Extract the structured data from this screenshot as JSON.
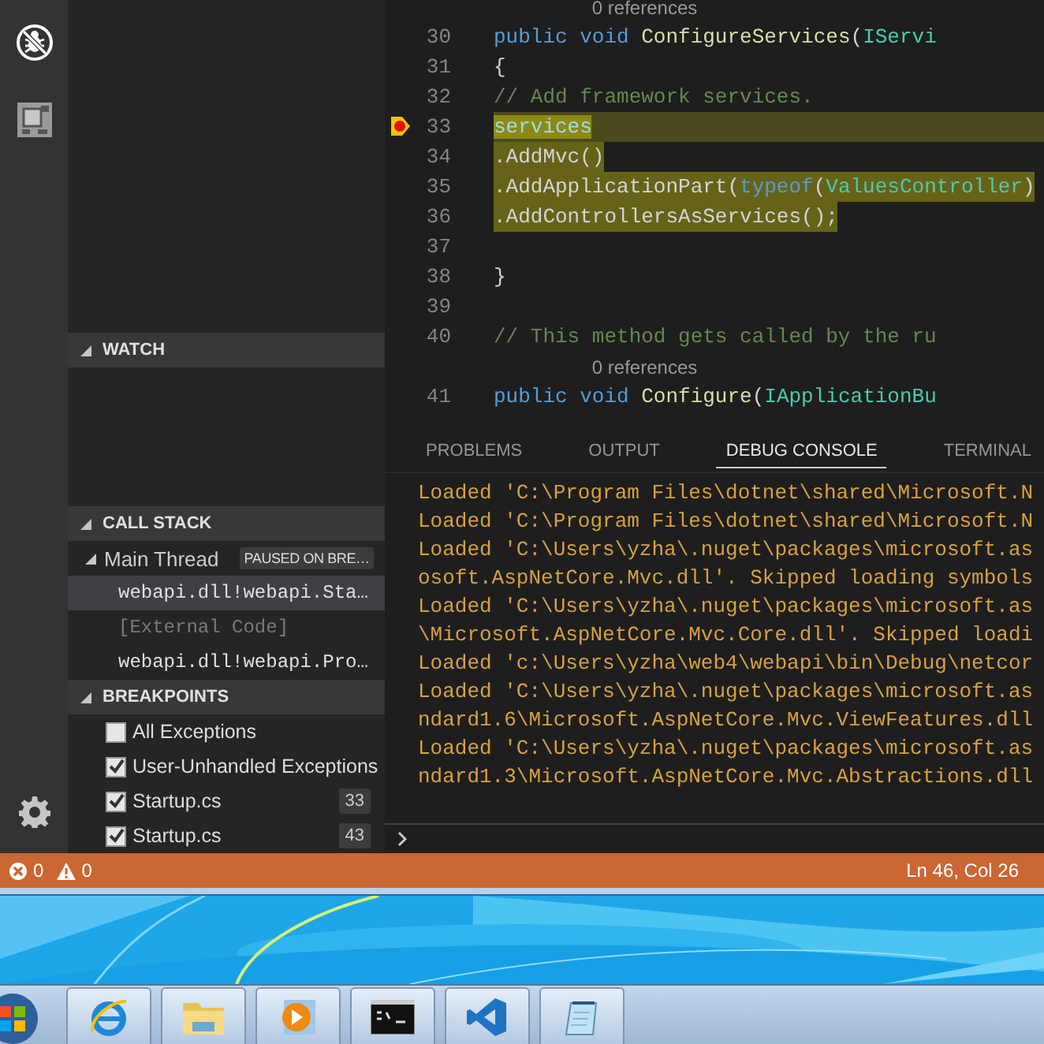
{
  "sidebar": {
    "watch": {
      "title": "WATCH",
      "expanded": true
    },
    "call_stack": {
      "title": "CALL STACK",
      "expanded": true,
      "thread": {
        "name": "Main Thread",
        "expanded": true,
        "badge": "PAUSED ON BRE…"
      },
      "frames": [
        {
          "label": "webapi.dll!webapi.Sta…",
          "kind": "frame",
          "selected": true
        },
        {
          "label": "[External Code]",
          "kind": "external",
          "selected": false
        },
        {
          "label": "webapi.dll!webapi.Pro…",
          "kind": "frame",
          "selected": false
        }
      ]
    },
    "breakpoints": {
      "title": "BREAKPOINTS",
      "expanded": true,
      "items": [
        {
          "label": "All Exceptions",
          "checked": false
        },
        {
          "label": "User-Unhandled Exceptions",
          "checked": true
        },
        {
          "label": "Startup.cs",
          "checked": true,
          "line": "33"
        },
        {
          "label": "Startup.cs",
          "checked": true,
          "line": "43"
        }
      ]
    }
  },
  "editor": {
    "lines": [
      {
        "kind": "codelens",
        "text": "        0 references"
      },
      {
        "kind": "code",
        "number": "30",
        "stopped": false,
        "current": false,
        "selected": false,
        "tokens": [
          {
            "kind": "keyword",
            "text": "        public "
          },
          {
            "kind": "keyword",
            "text": "void "
          },
          {
            "kind": "function",
            "text": "ConfigureServices"
          },
          {
            "kind": "plain",
            "text": "("
          },
          {
            "kind": "type",
            "text": "IServi"
          }
        ]
      },
      {
        "kind": "code",
        "number": "31",
        "stopped": false,
        "current": false,
        "selected": false,
        "tokens": [
          {
            "kind": "plain",
            "text": "        {"
          }
        ]
      },
      {
        "kind": "code",
        "number": "32",
        "stopped": false,
        "current": false,
        "selected": false,
        "tokens": [
          {
            "kind": "comment",
            "text": "            // Add framework services."
          }
        ]
      },
      {
        "kind": "code",
        "number": "33",
        "stopped": true,
        "current": true,
        "selected": false,
        "tokens": [
          {
            "kind": "variable",
            "text": "            services",
            "match": true
          }
        ]
      },
      {
        "kind": "code",
        "number": "34",
        "stopped": false,
        "current": false,
        "selected": true,
        "tokens": [
          {
            "kind": "plain",
            "text": "                .AddMvc()"
          }
        ]
      },
      {
        "kind": "code",
        "number": "35",
        "stopped": false,
        "current": false,
        "selected": true,
        "tokens": [
          {
            "kind": "plain",
            "text": ".AddApplicationPart("
          },
          {
            "kind": "keyword",
            "text": "typeof"
          },
          {
            "kind": "plain",
            "text": "("
          },
          {
            "kind": "type",
            "text": "ValuesController"
          },
          {
            "kind": "plain",
            "text": ")"
          }
        ]
      },
      {
        "kind": "code",
        "number": "36",
        "stopped": false,
        "current": false,
        "selected": true,
        "tokens": [
          {
            "kind": "plain",
            "text": ".AddControllersAsServices();"
          }
        ]
      },
      {
        "kind": "code",
        "number": "37",
        "stopped": false
      },
      {
        "kind": "code",
        "number": "38",
        "stopped": false,
        "current": false,
        "selected": false,
        "tokens": [
          {
            "kind": "plain",
            "text": "        }"
          }
        ]
      },
      {
        "kind": "code",
        "number": "39",
        "stopped": false
      },
      {
        "kind": "code",
        "number": "40",
        "stopped": false,
        "current": false,
        "selected": false,
        "tokens": [
          {
            "kind": "comment",
            "text": "        // This method gets called by the ru"
          }
        ]
      },
      {
        "kind": "codelens",
        "text": "        0 references"
      },
      {
        "kind": "code",
        "number": "41",
        "stopped": false,
        "current": false,
        "selected": false,
        "tokens": [
          {
            "kind": "keyword",
            "text": "        public "
          },
          {
            "kind": "keyword",
            "text": "void "
          },
          {
            "kind": "function",
            "text": "Configure"
          },
          {
            "kind": "plain",
            "text": "("
          },
          {
            "kind": "type",
            "text": "IApplicationBu"
          }
        ]
      }
    ]
  },
  "panel": {
    "tabs": [
      {
        "label": "PROBLEMS",
        "selected": false
      },
      {
        "label": "OUTPUT",
        "selected": false
      },
      {
        "label": "DEBUG CONSOLE",
        "selected": true
      },
      {
        "label": "TERMINAL",
        "selected": false
      }
    ],
    "console": [
      "Loaded 'C:\\Program Files\\dotnet\\shared\\Microsoft.N",
      "Loaded 'C:\\Program Files\\dotnet\\shared\\Microsoft.N",
      "Loaded 'C:\\Users\\yzha\\.nuget\\packages\\microsoft.as",
      "osoft.AspNetCore.Mvc.dll'. Skipped loading symbols",
      "Loaded 'C:\\Users\\yzha\\.nuget\\packages\\microsoft.as",
      "\\Microsoft.AspNetCore.Mvc.Core.dll'. Skipped loadi",
      "Loaded 'c:\\Users\\yzha\\web4\\webapi\\bin\\Debug\\netcor",
      "Loaded 'C:\\Users\\yzha\\.nuget\\packages\\microsoft.as",
      "ndard1.6\\Microsoft.AspNetCore.Mvc.ViewFeatures.dll",
      "Loaded 'C:\\Users\\yzha\\.nuget\\packages\\microsoft.as",
      "ndard1.3\\Microsoft.AspNetCore.Mvc.Abstractions.dll"
    ]
  },
  "status_bar": {
    "errors": "0",
    "warnings": "0",
    "position": "Ln 46, Col 26"
  }
}
